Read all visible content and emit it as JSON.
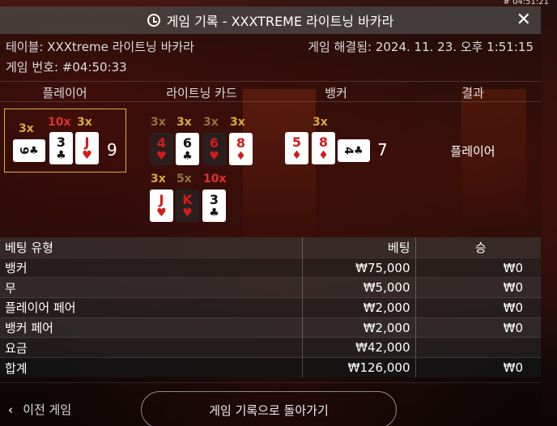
{
  "clock": "# 04:51:21",
  "header": {
    "title": "게임 기록 - XXXTREME 라이트닝 바카라",
    "close": "✕"
  },
  "info": {
    "table": "테이블: XXXtreme 라이트닝 바카라",
    "game_no": "게임 번호: #04:50:33",
    "resolved": "게임 해결됨: 2024. 11. 23. 오후 1:51:15"
  },
  "columns": {
    "player": "플레이어",
    "lightning": "라이트닝 카드",
    "banker": "뱅커",
    "result": "결과"
  },
  "player": {
    "score": "9",
    "cards": [
      {
        "rank": "9",
        "suit": "♣",
        "color": "black",
        "side": true,
        "mult": "3x",
        "mult_color": "gold"
      },
      {
        "rank": "3",
        "suit": "♣",
        "color": "black",
        "side": false,
        "mult": "10x",
        "mult_color": "red"
      },
      {
        "rank": "J",
        "suit": "♥",
        "color": "red",
        "side": false,
        "mult": "3x",
        "mult_color": "gold"
      }
    ]
  },
  "lightning_cards": [
    {
      "rank": "4",
      "suit": "♥",
      "color": "red",
      "dark": true,
      "mult": "3x",
      "mult_color": "dim"
    },
    {
      "rank": "6",
      "suit": "♣",
      "color": "black",
      "dark": false,
      "mult": "3x",
      "mult_color": "gold"
    },
    {
      "rank": "6",
      "suit": "♥",
      "color": "red",
      "dark": true,
      "mult": "3x",
      "mult_color": "dim"
    },
    {
      "rank": "8",
      "suit": "♦",
      "color": "red",
      "dark": false,
      "mult": "3x",
      "mult_color": "gold"
    },
    {
      "rank": "J",
      "suit": "♥",
      "color": "red",
      "dark": false,
      "mult": "3x",
      "mult_color": "gold"
    },
    {
      "rank": "K",
      "suit": "♥",
      "color": "red",
      "dark": true,
      "mult": "5x",
      "mult_color": "dim"
    },
    {
      "rank": "3",
      "suit": "♣",
      "color": "black",
      "dark": false,
      "mult": "10x",
      "mult_color": "red"
    }
  ],
  "banker": {
    "score": "7",
    "cards": [
      {
        "rank": "5",
        "suit": "♦",
        "color": "red",
        "side": false,
        "mult": ""
      },
      {
        "rank": "8",
        "suit": "♦",
        "color": "red",
        "side": false,
        "mult": "3x",
        "mult_color": "gold"
      },
      {
        "rank": "4",
        "suit": "♣",
        "color": "black",
        "side": true,
        "mult": ""
      }
    ]
  },
  "result": "플레이어",
  "bets": {
    "headers": [
      "베팅 유형",
      "베팅",
      "승"
    ],
    "rows": [
      [
        "뱅커",
        "₩75,000",
        "₩0"
      ],
      [
        "무",
        "₩5,000",
        "₩0"
      ],
      [
        "플레이어 페어",
        "₩2,000",
        "₩0"
      ],
      [
        "뱅커 페어",
        "₩2,000",
        "₩0"
      ],
      [
        "요금",
        "₩42,000",
        ""
      ]
    ],
    "total": [
      "합계",
      "₩126,000",
      "₩0"
    ]
  },
  "footer": {
    "prev": "이전 게임",
    "back": "게임 기록으로 돌아가기"
  },
  "colors": {
    "gold": "#d9a93b",
    "red_mult": "#e03030",
    "card_red": "#d41a1a",
    "highlight": "#e0b030"
  }
}
